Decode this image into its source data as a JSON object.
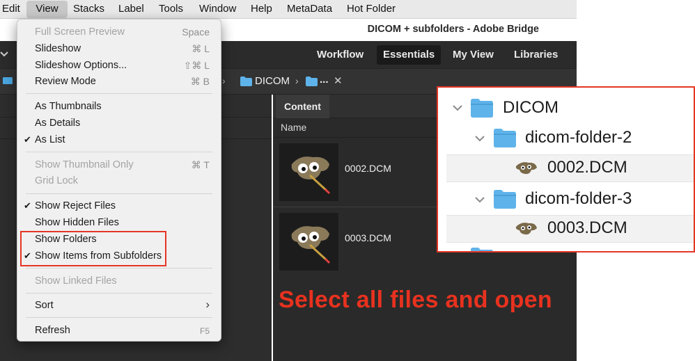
{
  "menubar": {
    "items": [
      "Edit",
      "View",
      "Stacks",
      "Label",
      "Tools",
      "Window",
      "Help",
      "MetaData",
      "Hot Folder"
    ]
  },
  "window": {
    "title": "DICOM + subfolders - Adobe Bridge"
  },
  "workspaces": {
    "items": [
      "Workflow",
      "Essentials",
      "My View",
      "Libraries"
    ],
    "active": "Essentials"
  },
  "pathbar": {
    "segment": "DICOM",
    "more": "..."
  },
  "content": {
    "tab": "Content",
    "column": "Name",
    "files": [
      "0002.DCM",
      "0003.DCM"
    ]
  },
  "view_menu": {
    "items": [
      {
        "label": "Full Screen Preview",
        "shortcut": "Space",
        "disabled": true
      },
      {
        "label": "Slideshow",
        "shortcut": "⌘ L"
      },
      {
        "label": "Slideshow Options...",
        "shortcut": "⇧⌘ L"
      },
      {
        "label": "Review Mode",
        "shortcut": "⌘ B"
      },
      {
        "label": "As Thumbnails"
      },
      {
        "label": "As Details"
      },
      {
        "label": "As List",
        "checked": true
      },
      {
        "label": "Show Thumbnail Only",
        "shortcut": "⌘ T",
        "disabled": true
      },
      {
        "label": "Grid Lock",
        "disabled": true
      },
      {
        "label": "Show Reject Files",
        "checked": true
      },
      {
        "label": "Show Hidden Files"
      },
      {
        "label": "Show Folders"
      },
      {
        "label": "Show Items from Subfolders",
        "checked": true
      },
      {
        "label": "Show Linked Files",
        "disabled": true
      },
      {
        "label": "Sort",
        "submenu": true
      },
      {
        "label": "Refresh",
        "shortcut": "F5"
      }
    ]
  },
  "callout": {
    "root": "DICOM",
    "folders": [
      {
        "name": "dicom-folder-2",
        "file": "0002.DCM"
      },
      {
        "name": "dicom-folder-3",
        "file": "0003.DCM"
      }
    ]
  },
  "instruction": "Select all files and open",
  "colors": {
    "highlight_red": "#e53524",
    "folder_blue": "#5eb3ea",
    "dark_panel": "#2b2b2b"
  }
}
